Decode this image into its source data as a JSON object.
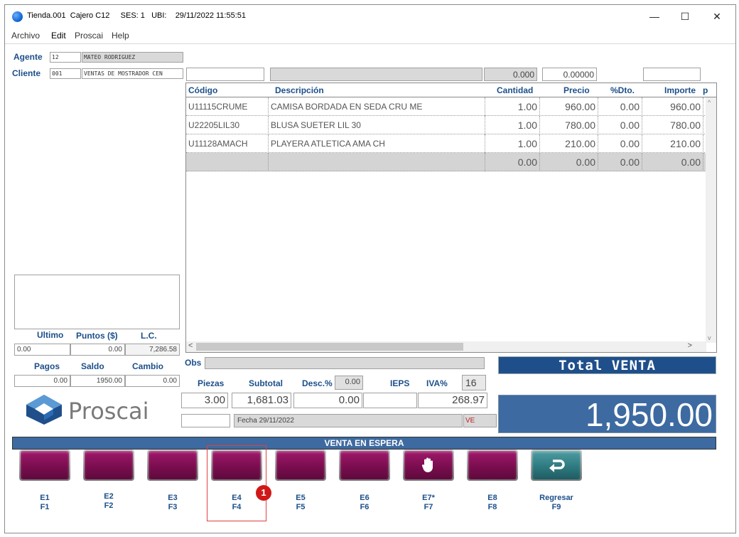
{
  "window": {
    "title": "Tienda.001  Cajero C12     SES: 1   UBI:    29/11/2022 11:55:51",
    "minimize": "—",
    "maximize": "☐",
    "close": "✕"
  },
  "menu": [
    "Archivo",
    "Edit",
    "Proscai",
    "Help"
  ],
  "agente": {
    "label": "Agente",
    "code": "12",
    "name": "MATEO RODRIGUEZ"
  },
  "cliente": {
    "label": "Cliente",
    "code": "001",
    "name": "VENTAS DE MOSTRADOR CEN"
  },
  "topfields": {
    "f1": "",
    "f2": "",
    "f3": "0.000",
    "f4": "0.00000",
    "f5": ""
  },
  "grid": {
    "headers": [
      "Código",
      "Descripción",
      "Cantidad",
      "Precio",
      "%Dto.",
      "Importe",
      "p"
    ],
    "rows": [
      {
        "codigo": "U11115CRUME",
        "descripcion": "CAMISA BORDADA EN SEDA CRU ME",
        "cantidad": "1.00",
        "precio": "960.00",
        "dto": "0.00",
        "importe": "960.00"
      },
      {
        "codigo": "U22205LIL30",
        "descripcion": "BLUSA SUETER LIL 30",
        "cantidad": "1.00",
        "precio": "780.00",
        "dto": "0.00",
        "importe": "780.00"
      },
      {
        "codigo": "U11128AMACH",
        "descripcion": "PLAYERA ATLETICA AMA CH",
        "cantidad": "1.00",
        "precio": "210.00",
        "dto": "0.00",
        "importe": "210.00"
      }
    ],
    "empty_row": {
      "cantidad": "0.00",
      "precio": "0.00",
      "dto": "0.00",
      "importe": "0.00"
    }
  },
  "left": {
    "ultimo_label": "Ultimo",
    "puntos_label": "Puntos ($)",
    "lc_label": "L.C.",
    "ultimo": "0.00",
    "puntos": "0.00",
    "lc": "7,286.58",
    "pagos_label": "Pagos",
    "saldo_label": "Saldo",
    "cambio_label": "Cambio",
    "pagos": "0.00",
    "saldo": "1950.00",
    "cambio": "0.00"
  },
  "logo": {
    "text": "Proscai"
  },
  "obs": {
    "label": "Obs",
    "value": ""
  },
  "totals": {
    "piezas_label": "Piezas",
    "subtotal_label": "Subtotal",
    "desc_label": "Desc.%",
    "desc_pct": "0.00",
    "ieps_label": "IEPS",
    "iva_label": "IVA%",
    "iva_pct": "16",
    "piezas": "3.00",
    "subtotal": "1,681.03",
    "descuento": "0.00",
    "ieps": "",
    "iva": "268.97",
    "fecha": "Fecha 29/11/2022",
    "ve": "VE"
  },
  "total_venta": {
    "label": "Total  VENTA",
    "value": "1,950.00"
  },
  "status": "VENTA EN ESPERA",
  "fkeys": [
    {
      "top": "E1",
      "bottom": "F1",
      "icon": ""
    },
    {
      "top": "E2",
      "bottom": "F2",
      "icon": ""
    },
    {
      "top": "E3",
      "bottom": "F3",
      "icon": ""
    },
    {
      "top": "E4",
      "bottom": "F4",
      "icon": ""
    },
    {
      "top": "E5",
      "bottom": "F5",
      "icon": ""
    },
    {
      "top": "E6",
      "bottom": "F6",
      "icon": ""
    },
    {
      "top": "E7*",
      "bottom": "F7",
      "icon": "hand-icon"
    },
    {
      "top": "E8",
      "bottom": "F8",
      "icon": ""
    },
    {
      "top": "Regresar",
      "bottom": "F9",
      "icon": "return-arrow-icon"
    }
  ],
  "badge": "1"
}
